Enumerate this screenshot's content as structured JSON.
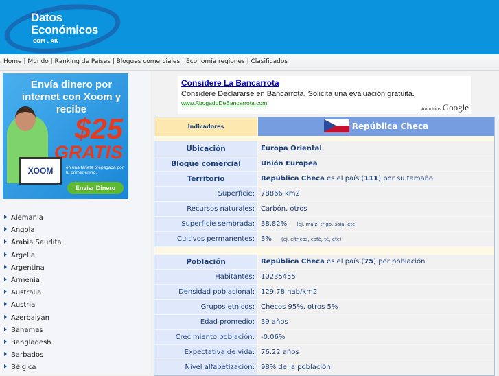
{
  "logo": {
    "line1": "Datos",
    "line2": "Económicos",
    "line3": "COM . AR"
  },
  "nav": [
    "Home",
    "Mundo",
    "Ranking de Países",
    "Bloques comerciales",
    "Economía regiones",
    "Clasificados"
  ],
  "banner": {
    "headline": "Envía dinero por internet con Xoom y recibe",
    "amount": "$25",
    "gratis": "GRATIS",
    "sub": "en una tarjeta prepagada por tu primer envío.",
    "brand": "XOOM",
    "button": "Enviar Dinero"
  },
  "countries": [
    "Alemania",
    "Angola",
    "Arabia Saudita",
    "Argelia",
    "Argentina",
    "Armenia",
    "Australia",
    "Austria",
    "Azerbaiyan",
    "Bahamas",
    "Bangladesh",
    "Barbados",
    "Bélgica"
  ],
  "ad": {
    "title": "Considere La Bancarrota",
    "text": "Considere Declararse en Bancarrota. Solicita una evaluación gratuita.",
    "url": "www.AbogadoDeBancarrota.com",
    "anuncios": "Anuncios",
    "google": "Google"
  },
  "table": {
    "header_left": "Indicadores",
    "country": "República Checa",
    "geo": [
      {
        "label": "Ubicación",
        "value": "Europa Oriental",
        "head": true
      },
      {
        "label": "Bloque comercial",
        "value": "Unión Europea",
        "head": true
      },
      {
        "label": "Territorio",
        "bold": "República Checa",
        "pre": " es el país (",
        "rank": "111",
        "post": ") por su tamaño",
        "head": true
      },
      {
        "label": "Superficie:",
        "value": "78866 km2"
      },
      {
        "label": "Recursos naturales:",
        "value": "Carbón, otros"
      },
      {
        "label": "Superficie sembrada:",
        "value": "38.82%",
        "note": "(ej. maiz, trigo, soja, etc)"
      },
      {
        "label": "Cultivos permanentes:",
        "value": "3%",
        "note": "(ej. citricos, café, té, etc)"
      }
    ],
    "pop": [
      {
        "label": "Población",
        "bold": "República Checa",
        "pre": " es el país (",
        "rank": "75",
        "post": ") por población",
        "head": true
      },
      {
        "label": "Habitantes:",
        "value": "10235455"
      },
      {
        "label": "Densidad poblacional:",
        "value": "129.78 hab/km2"
      },
      {
        "label": "Grupos etnicos:",
        "value": "Checos 95%, otros 5%"
      },
      {
        "label": "Edad promedio:",
        "value": "39 años"
      },
      {
        "label": "Crecimiento población:",
        "value": "-0.06%"
      },
      {
        "label": "Expectativa de vida:",
        "value": "76.22 años"
      },
      {
        "label": "Nivel alfabetización:",
        "value": "98% de la población"
      }
    ]
  }
}
